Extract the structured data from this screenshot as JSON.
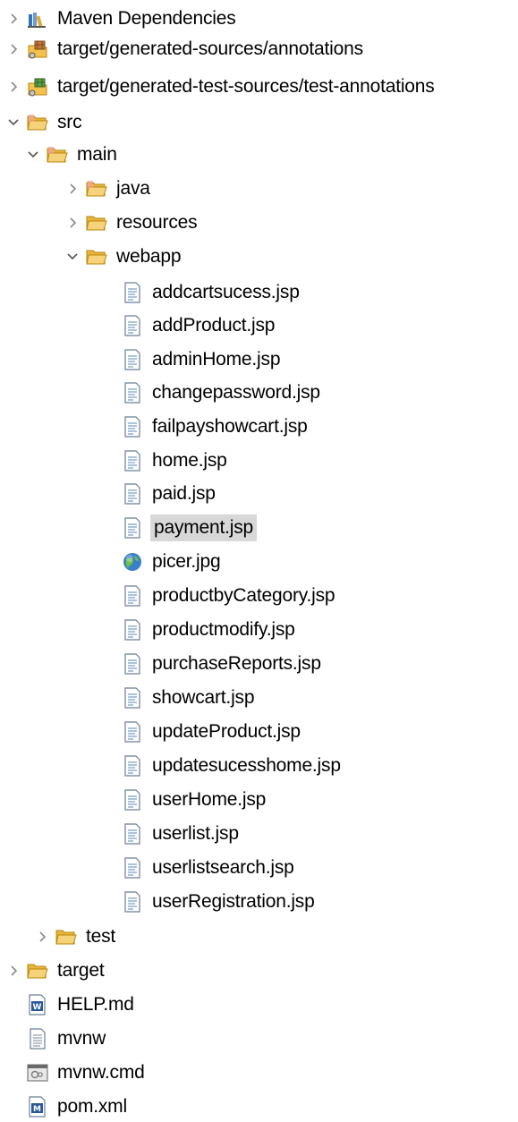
{
  "tree": {
    "items": [
      {
        "label": "Maven Dependencies",
        "icon": "library-icon",
        "arrow": "collapsed"
      },
      {
        "label": "target/generated-sources/annotations",
        "icon": "package-folder-icon",
        "arrow": "collapsed"
      },
      {
        "label": "target/generated-test-sources/test-annotations",
        "icon": "package-folder-icon",
        "arrow": "collapsed"
      },
      {
        "label": "src",
        "icon": "source-folder-icon",
        "arrow": "expanded"
      },
      {
        "label": "main",
        "icon": "source-folder-icon",
        "arrow": "expanded"
      },
      {
        "label": "java",
        "icon": "source-folder-icon",
        "arrow": "collapsed"
      },
      {
        "label": "resources",
        "icon": "folder-icon",
        "arrow": "collapsed"
      },
      {
        "label": "webapp",
        "icon": "folder-open-icon",
        "arrow": "expanded"
      },
      {
        "label": "addcartsucess.jsp",
        "icon": "jsp-file-icon"
      },
      {
        "label": "addProduct.jsp",
        "icon": "jsp-file-icon"
      },
      {
        "label": "adminHome.jsp",
        "icon": "jsp-file-icon"
      },
      {
        "label": "changepassword.jsp",
        "icon": "jsp-file-icon"
      },
      {
        "label": "failpayshowcart.jsp",
        "icon": "jsp-file-icon"
      },
      {
        "label": "home.jsp",
        "icon": "jsp-file-icon"
      },
      {
        "label": "paid.jsp",
        "icon": "jsp-file-icon"
      },
      {
        "label": "payment.jsp",
        "icon": "jsp-file-icon",
        "selected": true
      },
      {
        "label": "picer.jpg",
        "icon": "globe-image-icon"
      },
      {
        "label": "productbyCategory.jsp",
        "icon": "jsp-file-icon"
      },
      {
        "label": "productmodify.jsp",
        "icon": "jsp-file-icon"
      },
      {
        "label": "purchaseReports.jsp",
        "icon": "jsp-file-icon"
      },
      {
        "label": "showcart.jsp",
        "icon": "jsp-file-icon"
      },
      {
        "label": "updateProduct.jsp",
        "icon": "jsp-file-icon"
      },
      {
        "label": "updatesucesshome.jsp",
        "icon": "jsp-file-icon"
      },
      {
        "label": "userHome.jsp",
        "icon": "jsp-file-icon"
      },
      {
        "label": "userlist.jsp",
        "icon": "jsp-file-icon"
      },
      {
        "label": "userlistsearch.jsp",
        "icon": "jsp-file-icon"
      },
      {
        "label": "userRegistration.jsp",
        "icon": "jsp-file-icon"
      },
      {
        "label": "test",
        "icon": "folder-icon",
        "arrow": "collapsed"
      },
      {
        "label": "target",
        "icon": "folder-icon",
        "arrow": "collapsed"
      },
      {
        "label": "HELP.md",
        "icon": "word-file-icon"
      },
      {
        "label": "mvnw",
        "icon": "text-file-icon"
      },
      {
        "label": "mvnw.cmd",
        "icon": "cmd-file-icon"
      },
      {
        "label": "pom.xml",
        "icon": "maven-file-icon"
      }
    ]
  },
  "colors": {
    "selection": "#d8d8d8",
    "folder": "#f2c14e",
    "folder_stroke": "#b8860b",
    "arrow": "#8a8a8a"
  }
}
